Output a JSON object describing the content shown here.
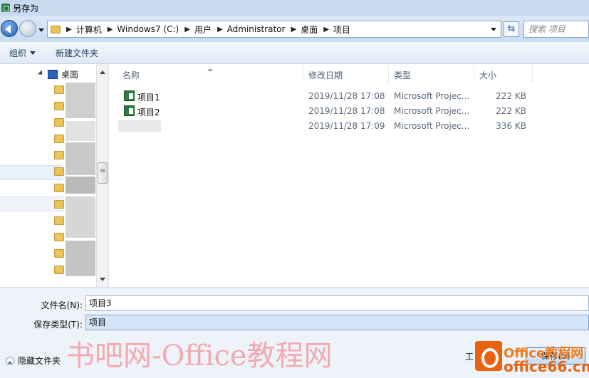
{
  "window": {
    "title": "另存为"
  },
  "address": {
    "crumbs": [
      "计算机",
      "Windows7 (C:)",
      "用户",
      "Administrator",
      "桌面",
      "项目"
    ],
    "search_placeholder": "搜索 项目"
  },
  "toolbar": {
    "organize": "组织",
    "new_folder": "新建文件夹"
  },
  "nav": {
    "root": "桌面"
  },
  "columns": {
    "name": "名称",
    "date": "修改日期",
    "type": "类型",
    "size": "大小"
  },
  "files": [
    {
      "name": "项目1",
      "date": "2019/11/28 17:08",
      "type": "Microsoft Projec...",
      "size": "222 KB"
    },
    {
      "name": "项目2",
      "date": "2019/11/28 17:08",
      "type": "Microsoft Projec...",
      "size": "222 KB"
    },
    {
      "name": "",
      "date": "2019/11/28 17:09",
      "type": "Microsoft Projec...",
      "size": "336 KB"
    }
  ],
  "form": {
    "filename_label": "文件名(N):",
    "filename_value": "项目3",
    "filetype_label": "保存类型(T):",
    "filetype_value": "项目",
    "hide_folders": "隐藏文件夹",
    "tools": "工",
    "save": "保存(S)"
  },
  "watermark": {
    "text": "书吧网-Office教程网",
    "brand_top": "Office教程网",
    "brand_bottom": "office66.cn"
  },
  "colors": {
    "titlebar": "#c8daf0",
    "accent": "#2b62c2",
    "watermark": "#f2aab0"
  }
}
